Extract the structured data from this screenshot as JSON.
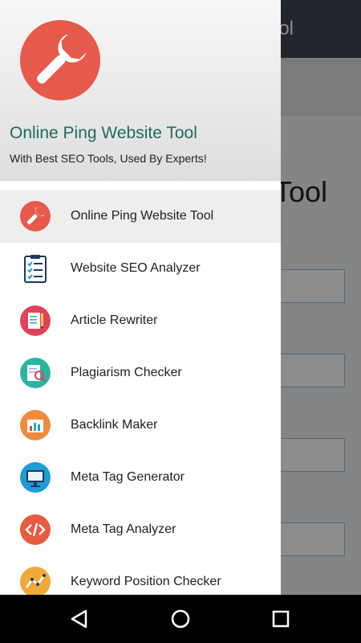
{
  "background_app": {
    "toolbar_title_fragment": "ol",
    "heading_fragment": "Tool"
  },
  "drawer": {
    "header": {
      "logo_icon": "wrench-icon",
      "title": "Online Ping Website Tool",
      "subtitle": "With Best SEO Tools, Used By Experts!"
    },
    "items": [
      {
        "label": "Online Ping Website Tool",
        "icon": "wrench-icon",
        "color": "#e55a4a",
        "active": true
      },
      {
        "label": "Website SEO Analyzer",
        "icon": "checklist-icon",
        "color": "#1f3a5f",
        "active": false
      },
      {
        "label": "Article Rewriter",
        "icon": "notepad-pencil-icon",
        "color": "#e0435a",
        "active": false
      },
      {
        "label": "Plagiarism Checker",
        "icon": "document-search-icon",
        "color": "#2bb5a0",
        "active": false
      },
      {
        "label": "Backlink Maker",
        "icon": "bar-chart-icon",
        "color": "#f28a3b",
        "active": false
      },
      {
        "label": "Meta Tag Generator",
        "icon": "monitor-icon",
        "color": "#1e9cd7",
        "active": false
      },
      {
        "label": "Meta Tag Analyzer",
        "icon": "code-icon",
        "color": "#e75b3f",
        "active": false
      },
      {
        "label": "Keyword Position Checker",
        "icon": "line-chart-icon",
        "color": "#f2a93b",
        "active": false
      }
    ]
  },
  "navbar": {
    "back_icon": "back-triangle-icon",
    "home_icon": "home-circle-icon",
    "recents_icon": "recents-square-icon"
  }
}
